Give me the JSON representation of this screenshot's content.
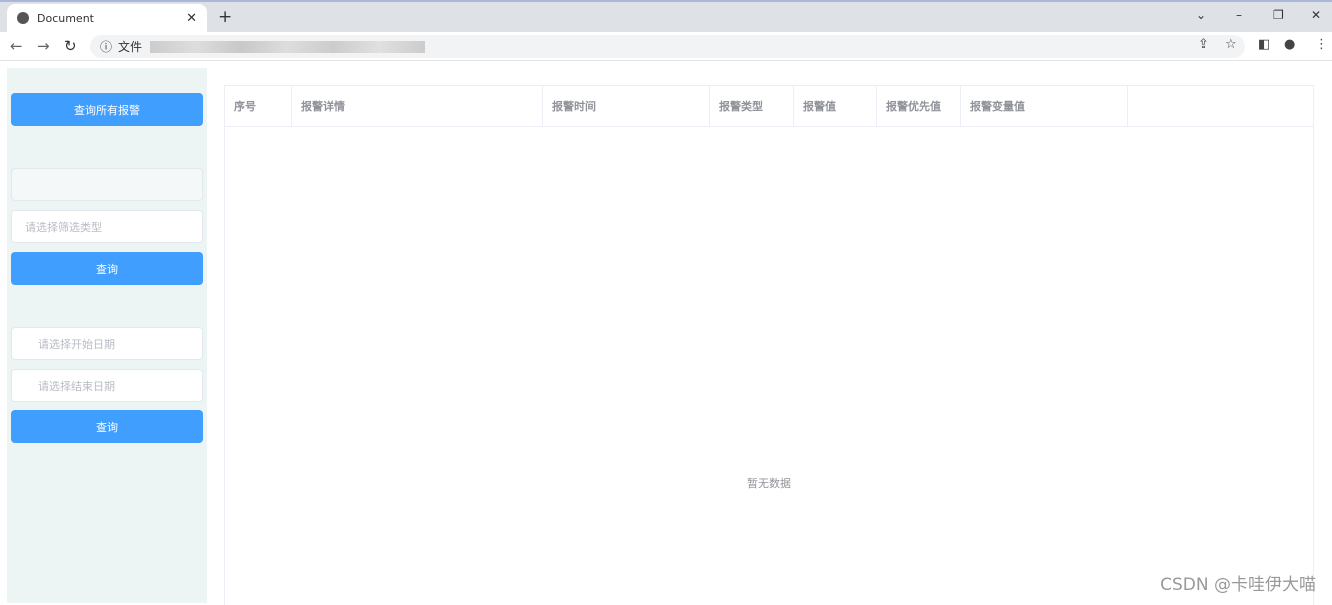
{
  "browser": {
    "tab_title": "Document",
    "address_prefix": "文件"
  },
  "sidebar": {
    "query_all_label": "查询所有报警",
    "filter_type_placeholder": "请选择筛选类型",
    "query_label_1": "查询",
    "start_date_placeholder": "请选择开始日期",
    "end_date_placeholder": "请选择结束日期",
    "query_label_2": "查询"
  },
  "table": {
    "columns": [
      "序号",
      "报警详情",
      "报警时间",
      "报警类型",
      "报警值",
      "报警优先值",
      "报警变量值"
    ],
    "empty_text": "暂无数据"
  },
  "watermark": "CSDN @卡哇伊大喵"
}
